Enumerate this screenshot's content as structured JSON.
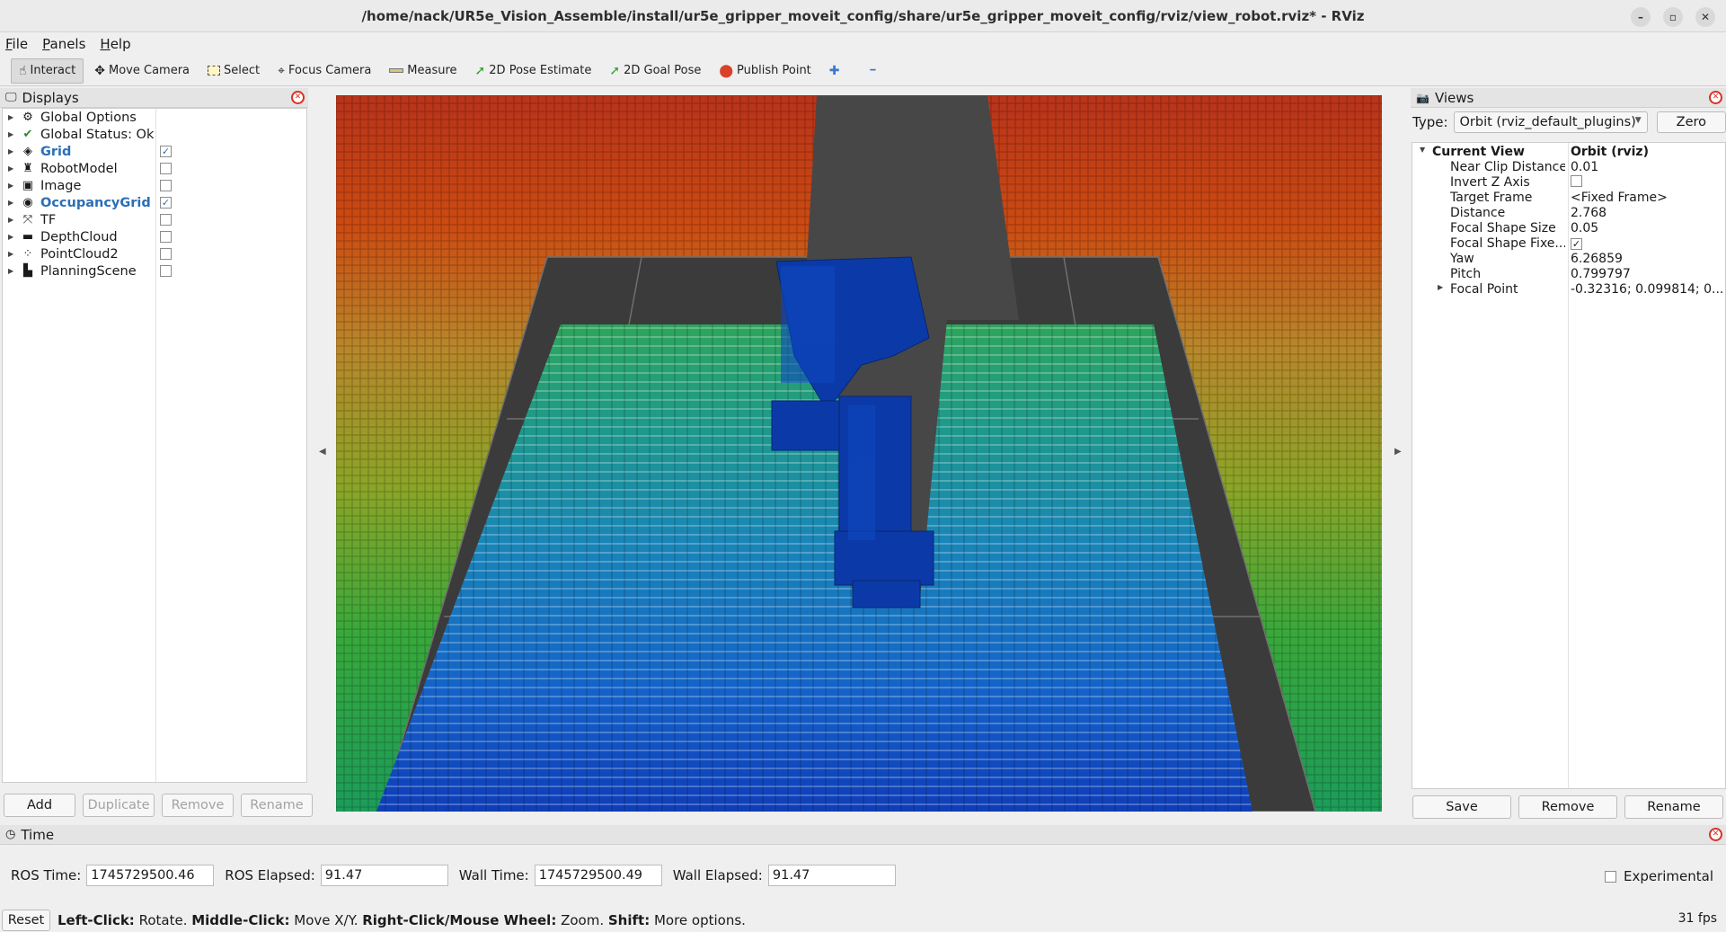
{
  "window": {
    "title": "/home/nack/UR5e_Vision_Assemble/install/ur5e_gripper_moveit_config/share/ur5e_gripper_moveit_config/rviz/view_robot.rviz* - RViz",
    "minimize": "–",
    "maximize": "▫",
    "close": "✕"
  },
  "menu": [
    "File",
    "Panels",
    "Help"
  ],
  "toolbar": {
    "interact": "Interact",
    "move_camera": "Move Camera",
    "select": "Select",
    "focus_camera": "Focus Camera",
    "measure": "Measure",
    "pose_estimate": "2D Pose Estimate",
    "goal_pose": "2D Goal Pose",
    "publish_point": "Publish Point",
    "plus": "✚",
    "minus": "━"
  },
  "displays": {
    "title": "Displays",
    "items": [
      {
        "label": "Global Options",
        "icon": "⚙",
        "checkbox": null
      },
      {
        "label": "Global Status: Ok",
        "icon": "✔",
        "checkbox": null
      },
      {
        "label": "Grid",
        "icon": "◈",
        "checkbox": true
      },
      {
        "label": "RobotModel",
        "icon": "♜",
        "checkbox": false
      },
      {
        "label": "Image",
        "icon": "▣",
        "checkbox": false
      },
      {
        "label": "OccupancyGrid",
        "icon": "◉",
        "checkbox": true
      },
      {
        "label": "TF",
        "icon": "⤧",
        "checkbox": false
      },
      {
        "label": "DepthCloud",
        "icon": "▬",
        "checkbox": false
      },
      {
        "label": "PointCloud2",
        "icon": "⁘",
        "checkbox": false
      },
      {
        "label": "PlanningScene",
        "icon": "▙",
        "checkbox": false
      }
    ],
    "buttons": {
      "add": "Add",
      "duplicate": "Duplicate",
      "remove": "Remove",
      "rename": "Rename"
    }
  },
  "views": {
    "title": "Views",
    "type_label": "Type:",
    "type_value": "Orbit (rviz_default_plugins)",
    "zero": "Zero",
    "current_view": {
      "label": "Current View",
      "value": "Orbit (rviz)"
    },
    "properties": [
      {
        "k": "Near Clip Distance",
        "v": "0.01"
      },
      {
        "k": "Invert Z Axis",
        "v": ""
      },
      {
        "k": "Target Frame",
        "v": "<Fixed Frame>"
      },
      {
        "k": "Distance",
        "v": "2.768"
      },
      {
        "k": "Focal Shape Size",
        "v": "0.05"
      },
      {
        "k": "Focal Shape Fixe...",
        "v": "✓"
      },
      {
        "k": "Yaw",
        "v": "6.26859"
      },
      {
        "k": "Pitch",
        "v": "0.799797"
      },
      {
        "k": "Focal Point",
        "v": "-0.32316; 0.099814; 0...."
      }
    ],
    "buttons": {
      "save": "Save",
      "remove": "Remove",
      "rename": "Rename"
    }
  },
  "time": {
    "title": "Time",
    "ros_time_label": "ROS Time:",
    "ros_time": "1745729500.46",
    "ros_elapsed_label": "ROS Elapsed:",
    "ros_elapsed": "91.47",
    "wall_time_label": "Wall Time:",
    "wall_time": "1745729500.49",
    "wall_elapsed_label": "Wall Elapsed:",
    "wall_elapsed": "91.47",
    "experimental": "Experimental"
  },
  "status": {
    "reset": "Reset",
    "hint_1b": "Left-Click:",
    "hint_1": " Rotate. ",
    "hint_2b": "Middle-Click:",
    "hint_2": " Move X/Y. ",
    "hint_3b": "Right-Click/Mouse Wheel:",
    "hint_3": " Zoom. ",
    "hint_4b": "Shift:",
    "hint_4": " More options.",
    "fps": "31 fps"
  },
  "colors": {
    "accent": "#2b6fb6",
    "bg": "#efefef",
    "grid_floor": "#3a3a3a"
  }
}
